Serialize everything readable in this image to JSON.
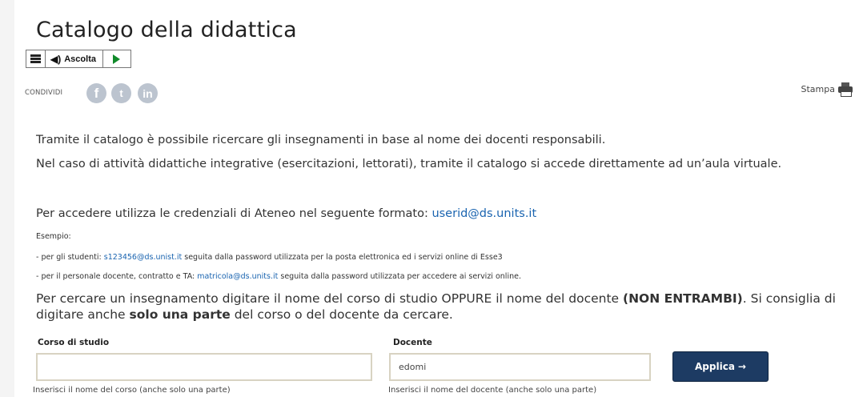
{
  "page": {
    "title": "Catalogo della didattica"
  },
  "player": {
    "listen_label": "Ascolta",
    "icons": [
      "menu-icon",
      "speaker-icon",
      "play-icon"
    ]
  },
  "share": {
    "label": "CONDIVIDI",
    "networks": [
      "f",
      "t",
      "in"
    ],
    "print_label": "Stampa"
  },
  "intro": {
    "line1": "Tramite il catalogo è possibile ricercare gli insegnamenti in base al nome dei docenti responsabili.",
    "line2": "Nel caso di attività didattiche integrative (esercitazioni, lettorati), tramite il catalogo si accede direttamente ad un’aula virtuale."
  },
  "access": {
    "text": "Per accedere utilizza le credenziali di Ateneo nel seguente formato: ",
    "link": "userid@ds.units.it",
    "example_label": "Esempio:",
    "students_prefix": "- per gli studenti: ",
    "students_link": "s123456@ds.unist.it",
    "students_suffix": " seguita dalla password utilizzata per la posta elettronica ed i servizi online di Esse3",
    "staff_prefix": "- per il personale docente, contratto e TA: ",
    "staff_link": "matricola@ds.units.it",
    "staff_suffix": " seguita dalla password utilizzata per accedere ai servizi online."
  },
  "search_hint": {
    "part1": "Per cercare un insegnamento digitare il nome del corso di studio OPPURE il nome del docente ",
    "part2": "(NON ENTRAMBI)",
    "part3": ". Si consiglia di digitare anche ",
    "part4": "solo una parte",
    "part5": " del corso o del docente da cercare."
  },
  "form": {
    "corso_label": "Corso di studio",
    "corso_value": "",
    "corso_help": "Inserisci il nome del corso (anche solo una parte)",
    "docente_label": "Docente",
    "docente_value": "edomi",
    "docente_help": "Inserisci il nome del docente (anche solo una parte)",
    "apply_label": "Applica",
    "apply_arrow": "→"
  }
}
